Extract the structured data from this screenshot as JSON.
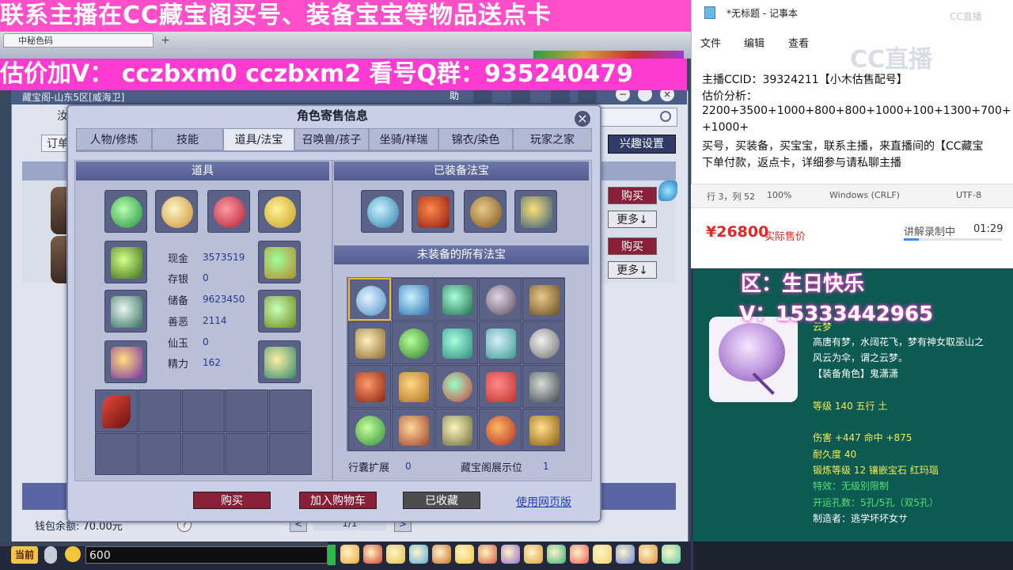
{
  "banners": {
    "top": "联系主播在CC藏宝阁买号、装备宝宝等物品送点卡",
    "second": "估价加V：  cczbxm0   cczbxm2   看号Q群：935240479"
  },
  "game_window": {
    "tab_title": "中秘色码",
    "header_text": "藏宝阁-山东5区[威海卫]",
    "search_prefix": "订单",
    "interest_settings": "兴趣设置",
    "side_buttons": {
      "buy": "购买",
      "more": "更多↓"
    },
    "wallet": "钱包余额: 70.00元",
    "help": "?",
    "pager": {
      "prev": "<",
      "page": "1/1",
      "next": ">"
    }
  },
  "dialog": {
    "title": "角色寄售信息",
    "close": "×",
    "tabs": [
      "人物/修炼",
      "技能",
      "道具/法宝",
      "召唤兽/孩子",
      "坐骑/祥瑞",
      "锦衣/染色",
      "玩家之家"
    ],
    "active_tab": "道具/法宝",
    "props_header": "道具",
    "equipped_header": "已装备法宝",
    "unequipped_header": "未装备的所有法宝",
    "stats": [
      {
        "label": "现金",
        "value": "3573519"
      },
      {
        "label": "存银",
        "value": "0"
      },
      {
        "label": "储备",
        "value": "9623450"
      },
      {
        "label": "善恶",
        "value": "2114"
      },
      {
        "label": "仙玉",
        "value": "0"
      },
      {
        "label": "精力",
        "value": "162"
      }
    ],
    "bag_expand_label": "行囊扩展",
    "bag_expand_value": "0",
    "cbg_slots_label": "藏宝阁展示位",
    "cbg_slots_value": "1",
    "buttons": {
      "buy": "购买",
      "add_cart": "加入购物车",
      "favorited": "已收藏",
      "web": "使用网页版"
    }
  },
  "bottom_bar": {
    "current": "当前",
    "chat_value": "600"
  },
  "notepad": {
    "title": "*无标题 - 记事本",
    "menu": [
      "文件",
      "编辑",
      "查看"
    ],
    "logo": "CC直播",
    "lines": [
      "主播CCID：39324211【小木估售配号】",
      "估价分析：",
      "2200+3500+1000+800+800+1000+100+1300+700+",
      "+1000+",
      "买号，买装备，买宝宝，联系主播，来直播间的【CC藏宝",
      "下单付款，返点卡，详细参与请私聊主播"
    ],
    "status": {
      "position": "行 3，列 52",
      "zoom": "100%",
      "eol": "Windows (CRLF)",
      "encoding": "UTF-8"
    }
  },
  "price_panel": {
    "price": "¥26800",
    "price_label": "实际售价",
    "recording": "讲解录制中",
    "time": "01:29",
    "progress": 0.15
  },
  "overlay": {
    "line1": "区：生日快乐",
    "line2": "V：15333442965"
  },
  "item_tooltip": {
    "name": "云梦",
    "desc1": "高唐有梦，水阔花飞，梦有神女取巫山之",
    "desc2": "风云为伞，谓之云梦。",
    "role": "【装备角色】鬼潇潇",
    "level": "等级 140 五行 土",
    "damage": "伤害 +447 命中 +875",
    "durability": "耐久度 40",
    "forge": "锻炼等级 12 镶嵌宝石 红玛瑙",
    "effect": "特效：无级别限制",
    "holes": "开运孔数：5孔/5孔（双5孔）",
    "maker": "制造者：逃学坏坏女サ"
  },
  "colors": {
    "accent_pink": "#ff3ad0",
    "price_red": "#e82424",
    "tooltip_bg": "#0c5a52",
    "button_red": "#8a2038"
  }
}
